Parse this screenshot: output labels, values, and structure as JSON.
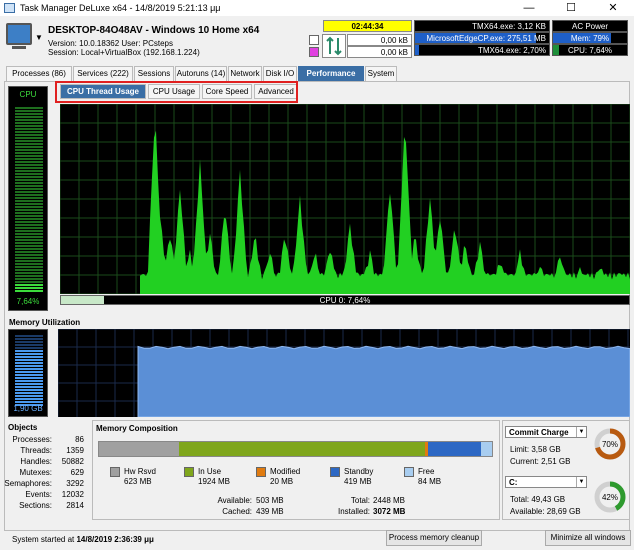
{
  "window": {
    "title": "Task Manager DeLuxe x64 - 14/8/2019 5:21:13 μμ",
    "minimize": "—",
    "maximize": "☐",
    "close": "✕"
  },
  "header": {
    "hostname": "DESKTOP-84O48AV - Windows 10 Home x64",
    "version_line": "Version: 10.0.18362    User: PCsteps",
    "session_line": "Session: Local+VirtualBox (192.168.1.224)",
    "uptime": "02:44:34",
    "net_in": "0,00 kB",
    "net_out": "0,00 kB",
    "top_processes": [
      {
        "label": "TMX64.exe: 3,12 KB",
        "fill": 0
      },
      {
        "label": "MicrosoftEdgeCP.exe: 275,51 MB",
        "fill": 0.9
      },
      {
        "label": "TMX64.exe: 2,70%",
        "fill": 0.03
      }
    ],
    "system_status": [
      {
        "label": "AC Power",
        "fill": 0,
        "color": "#000000"
      },
      {
        "label": "Mem: 79%",
        "fill": 0.79,
        "color": "#1e5fc8"
      },
      {
        "label": "CPU: 7,64%",
        "fill": 0.0764,
        "color": "#1e8f3a"
      }
    ]
  },
  "tabs": [
    {
      "label": "Processes (86)"
    },
    {
      "label": "Services (222)"
    },
    {
      "label": "Sessions"
    },
    {
      "label": "Autoruns (14)"
    },
    {
      "label": "Network"
    },
    {
      "label": "Disk I/O"
    },
    {
      "label": "Performance"
    },
    {
      "label": "System"
    }
  ],
  "subtabs": [
    {
      "label": "CPU Thread Usage"
    },
    {
      "label": "CPU Usage"
    },
    {
      "label": "Core Speed"
    },
    {
      "label": "Advanced"
    }
  ],
  "cpu": {
    "meter_label": "CPU",
    "meter_value": "7,64%",
    "usage_fraction": 0.0764,
    "bar_text": "CPU 0: 7,64%"
  },
  "memory": {
    "section_title": "Memory Utilization",
    "meter_value": "1,90 GB",
    "usage_fraction": 0.79
  },
  "objects": {
    "title": "Objects",
    "rows": [
      {
        "k": "Processes:",
        "v": "86"
      },
      {
        "k": "Threads:",
        "v": "1359"
      },
      {
        "k": "Handles:",
        "v": "50882"
      },
      {
        "k": "Mutexes:",
        "v": "629"
      },
      {
        "k": "Semaphores:",
        "v": "3292"
      },
      {
        "k": "Events:",
        "v": "12032"
      },
      {
        "k": "Sections:",
        "v": "2814"
      }
    ]
  },
  "memory_composition": {
    "title": "Memory Composition",
    "segments": [
      {
        "name": "Hw Rsvd",
        "value": "623 MB",
        "color": "#a0a0a0"
      },
      {
        "name": "In Use",
        "value": "1924 MB",
        "color": "#7fa61c"
      },
      {
        "name": "Modified",
        "value": "20 MB",
        "color": "#e07b10"
      },
      {
        "name": "Standby",
        "value": "419 MB",
        "color": "#2d68c4"
      },
      {
        "name": "Free",
        "value": "84 MB",
        "color": "#a8cdf0"
      }
    ],
    "available_label": "Available:",
    "available": "503 MB",
    "cached_label": "Cached:",
    "cached": "439 MB",
    "total_label": "Total:",
    "total": "2448 MB",
    "installed_label": "Installed:",
    "installed": "3072 MB"
  },
  "commit": {
    "select_value": "Commit Charge",
    "limit": "Limit: 3,58 GB",
    "current": "Current: 2,51 GB",
    "percent": "70%",
    "fraction": 0.7,
    "color": "#b85a10"
  },
  "disk": {
    "select_value": "C:",
    "total": "Total: 49,43 GB",
    "available": "Available: 28,69 GB",
    "percent": "42%",
    "fraction": 0.42,
    "color": "#2e9a2e"
  },
  "footer": {
    "started_prefix": "System started at",
    "started_time": "14/8/2019 2:36:39 μμ",
    "cleanup_button": "Process memory cleanup",
    "minimize_all_button": "Minimize all windows"
  }
}
